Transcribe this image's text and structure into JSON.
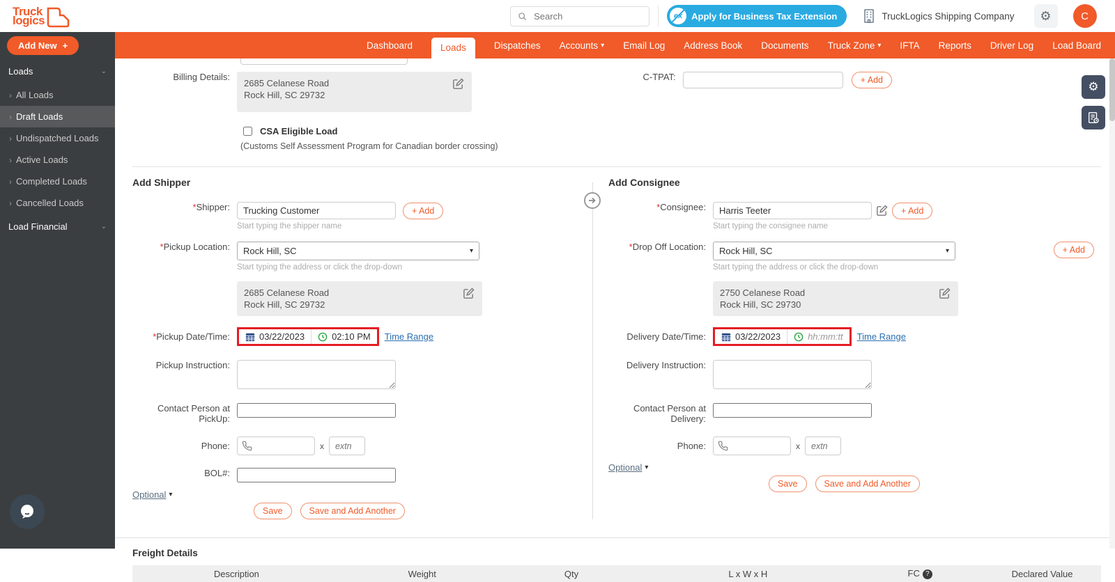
{
  "icons": {
    "caret_down": "▾",
    "chevron_down": "⌄",
    "item_chevron": "›",
    "gear": "⚙",
    "question": "?",
    "plus": "+",
    "arrow_right": "➔"
  },
  "misc": {
    "required": "*",
    "x": "x"
  },
  "header": {
    "logo_line1": "Truck",
    "logo_line2": "logics",
    "search_placeholder": "Search",
    "tax_icon_text": "ex",
    "tax_extension_button": "Apply for Business Tax Extension",
    "company_name": "TruckLogics Shipping Company",
    "avatar_initial": "C"
  },
  "nav": {
    "items": [
      {
        "label": "Dashboard"
      },
      {
        "label": "Loads"
      },
      {
        "label": "Dispatches"
      },
      {
        "label": "Accounts"
      },
      {
        "label": "Email Log"
      },
      {
        "label": "Address Book"
      },
      {
        "label": "Documents"
      },
      {
        "label": "Truck Zone"
      },
      {
        "label": "IFTA"
      },
      {
        "label": "Reports"
      },
      {
        "label": "Driver Log"
      },
      {
        "label": "Load Board"
      }
    ]
  },
  "sidebar": {
    "add_new_label": "Add New",
    "loads_header": "Loads",
    "items": [
      "All Loads",
      "Draft Loads",
      "Undispatched Loads",
      "Active Loads",
      "Completed Loads",
      "Cancelled Loads"
    ],
    "active_item": "Draft Loads",
    "financial_header": "Load Financial"
  },
  "billing": {
    "label": "Billing Details:",
    "address_line1": "2685 Celanese Road",
    "address_line2": "Rock Hill, SC 29732"
  },
  "ctpat": {
    "label": "C-TPAT:",
    "add_button": "+ Add"
  },
  "csa": {
    "label": "CSA Eligible Load",
    "note": "(Customs Self Assessment Program for Canadian border crossing)"
  },
  "shipper": {
    "title": "Add Shipper",
    "shipper_label": "Shipper:",
    "shipper_value": "Trucking Customer",
    "add_button": "+ Add",
    "shipper_helper": "Start typing the shipper name",
    "pickup_location_label": "Pickup Location:",
    "pickup_location_value": "Rock Hill, SC",
    "pickup_location_helper": "Start typing the address or click the drop-down",
    "address_line1": "2685 Celanese Road",
    "address_line2": "Rock Hill, SC 29732",
    "datetime_label": "Pickup Date/Time:",
    "date_value": "03/22/2023",
    "time_value": "02:10 PM",
    "time_range_link": "Time Range",
    "instruction_label": "Pickup Instruction:",
    "contact_label": "Contact Person at PickUp:",
    "phone_label": "Phone:",
    "extn_placeholder": "extn",
    "bol_label": "BOL#:",
    "optional_link": "Optional",
    "save_button": "Save",
    "save_add_button": "Save and Add Another"
  },
  "consignee": {
    "title": "Add Consignee",
    "consignee_label": "Consignee:",
    "consignee_value": "Harris Teeter",
    "add_button": "+ Add",
    "consignee_helper": "Start typing the consignee name",
    "dropoff_label": "Drop Off Location:",
    "dropoff_value": "Rock Hill, SC",
    "dropoff_add_button": "+ Add",
    "dropoff_helper": "Start typing the address or click the drop-down",
    "address_line1": "2750 Celanese Road",
    "address_line2": "Rock Hill, SC 29730",
    "datetime_label": "Delivery Date/Time:",
    "date_value": "03/22/2023",
    "time_placeholder": "hh:mm:tt",
    "time_range_link": "Time Range",
    "instruction_label": "Delivery Instruction:",
    "contact_label_line1": "Contact Person at",
    "contact_label_line2": "Delivery:",
    "phone_label": "Phone:",
    "extn_placeholder": "extn",
    "optional_link": "Optional",
    "save_button": "Save",
    "save_add_button": "Save and Add Another"
  },
  "freight": {
    "title": "Freight Details",
    "columns": [
      "Description",
      "Weight",
      "Qty",
      "L x W x H",
      "FC",
      "Declared Value"
    ]
  },
  "colors": {
    "accent_orange": "#f15a29",
    "tax_blue": "#29abe2",
    "link_blue": "#2a6fb0",
    "highlight_red": "#e51c23",
    "calendar_blue": "#2d4f8e",
    "clock_green": "#27a844",
    "sidebar_dark": "#3b3e40"
  }
}
